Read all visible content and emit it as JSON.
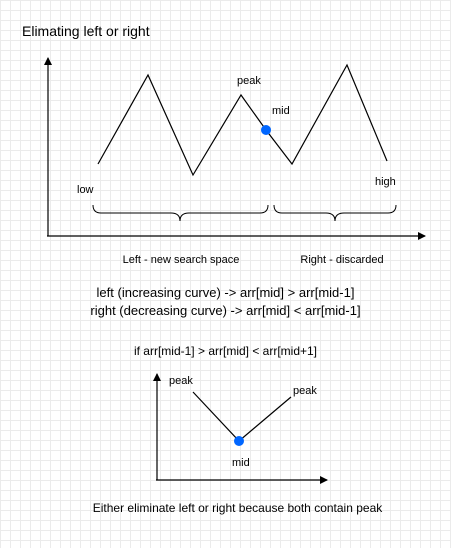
{
  "title": "Elimating left or right",
  "diagram1": {
    "labels": {
      "low": "low",
      "peak": "peak",
      "mid": "mid",
      "high": "high",
      "left_space": "Left - new search space",
      "right_space": "Right - discarded"
    }
  },
  "conditions": {
    "left": "left (increasing curve) -> arr[mid] > arr[mid-1]",
    "right": "right (decreasing curve) -> arr[mid] < arr[mid-1]",
    "valley": "if arr[mid-1] > arr[mid] < arr[mid+1]"
  },
  "diagram2": {
    "labels": {
      "peak_left": "peak",
      "peak_right": "peak",
      "mid": "mid"
    }
  },
  "footer": "Either eliminate left or right because both contain peak",
  "colors": {
    "line": "#000000",
    "dot": "#0066ff",
    "grid": "#ebebeb"
  }
}
